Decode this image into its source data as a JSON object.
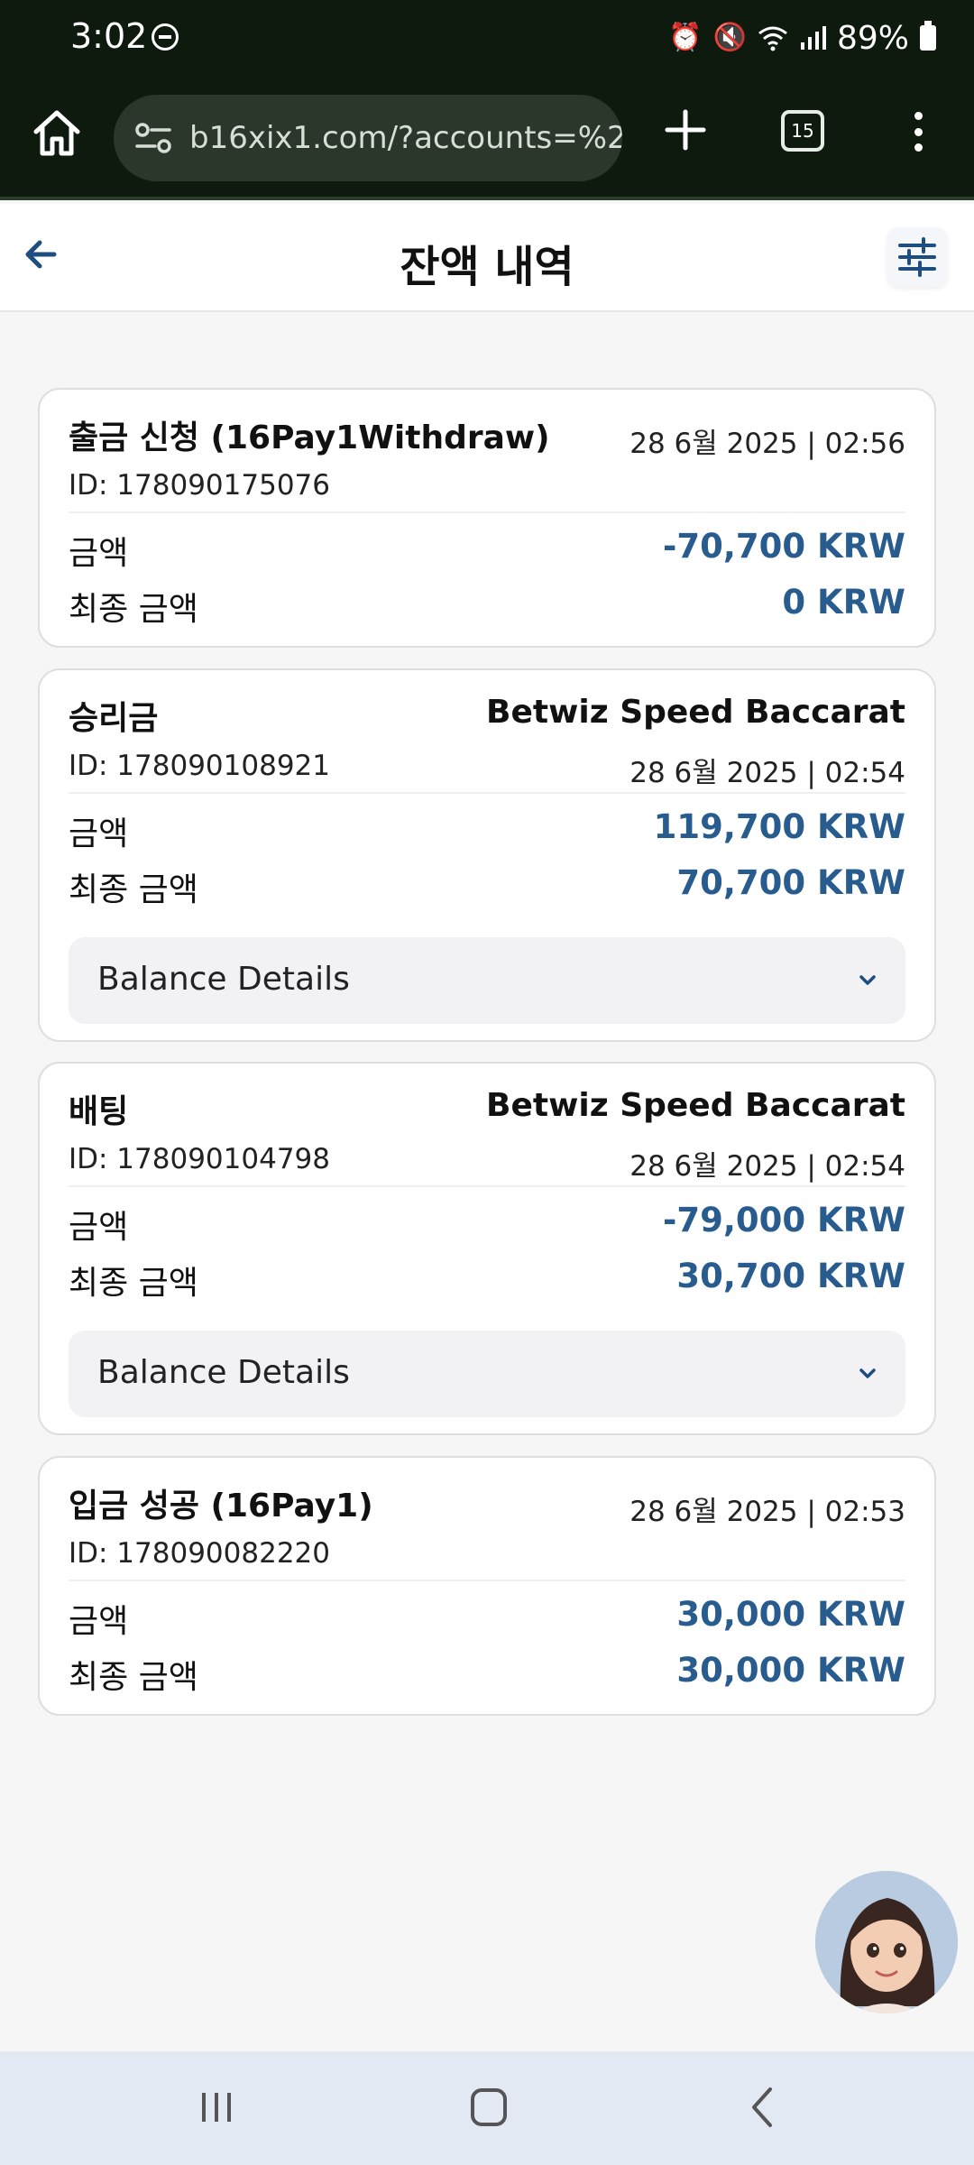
{
  "status_bar": {
    "time": "3:02",
    "battery": "89%"
  },
  "browser": {
    "url": "b16xix1.com/?accounts=%2",
    "tab_count": "15"
  },
  "header": {
    "title": "잔액 내역"
  },
  "transactions": [
    {
      "title": "출금 신청 (16Pay1Withdraw)",
      "source": "",
      "id": "ID: 178090175076",
      "datetime": "28 6월 2025 | 02:56",
      "amount_label": "금액",
      "amount": "-70,700 KRW",
      "final_label": "최종 금액",
      "final": "0 KRW",
      "has_details": false
    },
    {
      "title": "승리금",
      "source": "Betwiz Speed Baccarat",
      "id": "ID: 178090108921",
      "datetime": "28 6월 2025 | 02:54",
      "amount_label": "금액",
      "amount": "119,700 KRW",
      "final_label": "최종 금액",
      "final": "70,700 KRW",
      "has_details": true,
      "details_label": "Balance Details"
    },
    {
      "title": "배팅",
      "source": "Betwiz Speed Baccarat",
      "id": "ID: 178090104798",
      "datetime": "28 6월 2025 | 02:54",
      "amount_label": "금액",
      "amount": "-79,000 KRW",
      "final_label": "최종 금액",
      "final": "30,700 KRW",
      "has_details": true,
      "details_label": "Balance Details"
    },
    {
      "title": "입금 성공 (16Pay1)",
      "source": "",
      "id": "ID: 178090082220",
      "datetime": "28 6월 2025 | 02:53",
      "amount_label": "금액",
      "amount": "30,000 KRW",
      "final_label": "최종 금액",
      "final": "30,000 KRW",
      "has_details": false
    }
  ],
  "colors": {
    "amount": "#285c8e",
    "browser_bg": "#0e1a0e",
    "nav_bg": "#e2e9f2"
  },
  "icons": [
    "home-icon",
    "site-settings-icon",
    "plus-icon",
    "tabs-icon",
    "more-vert-icon",
    "arrow-left-icon",
    "sliders-icon",
    "chevron-down-icon",
    "recent-apps-icon",
    "home-nav-icon",
    "back-nav-icon"
  ]
}
